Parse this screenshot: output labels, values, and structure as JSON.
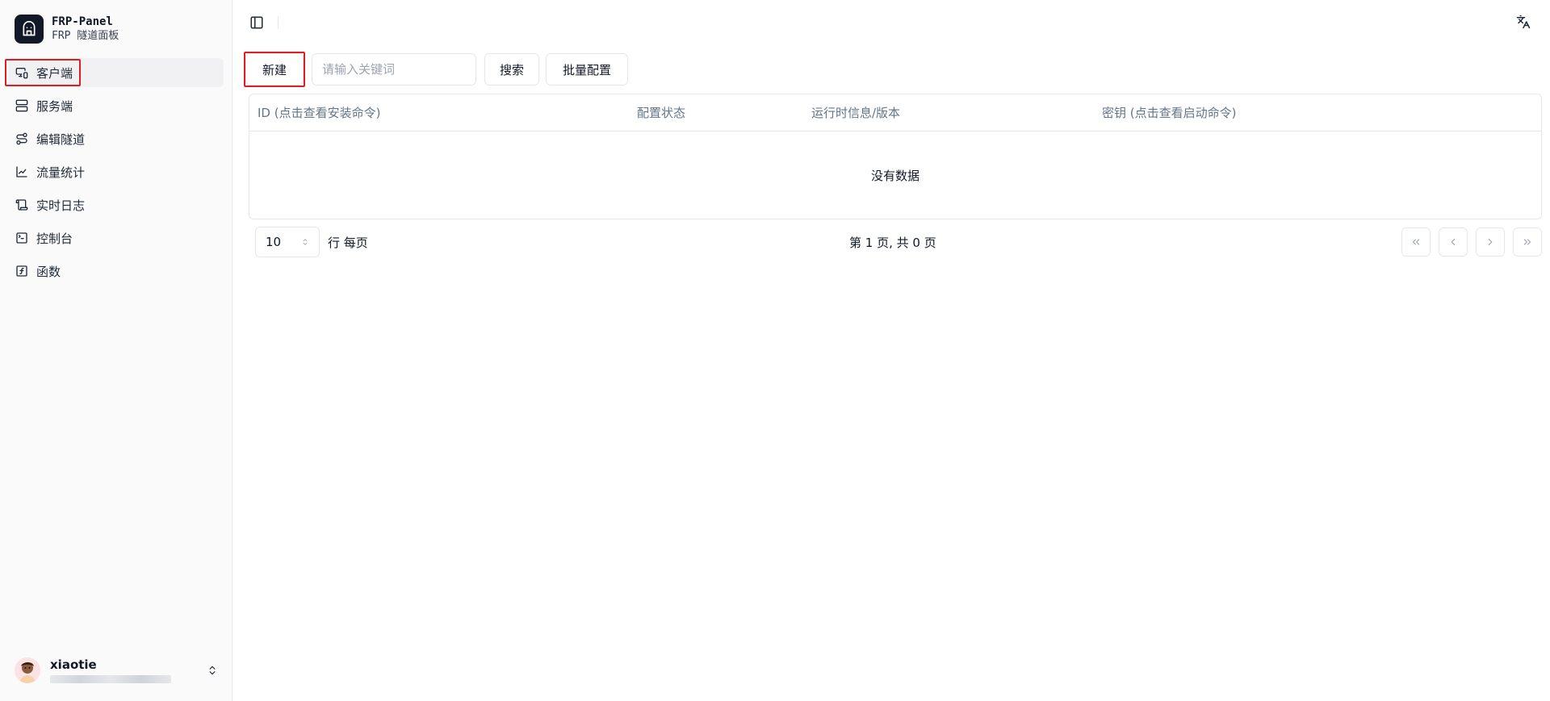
{
  "brand": {
    "title": "FRP-Panel",
    "subtitle": "FRP 隧道面板",
    "logo_icon": "building-icon"
  },
  "sidebar": {
    "items": [
      {
        "label": "客户端",
        "icon": "monitor-smartphone-icon",
        "active": true
      },
      {
        "label": "服务端",
        "icon": "server-icon",
        "active": false
      },
      {
        "label": "编辑隧道",
        "icon": "route-icon",
        "active": false
      },
      {
        "label": "流量统计",
        "icon": "chart-icon",
        "active": false
      },
      {
        "label": "实时日志",
        "icon": "scroll-icon",
        "active": false
      },
      {
        "label": "控制台",
        "icon": "terminal-icon",
        "active": false
      },
      {
        "label": "函数",
        "icon": "function-icon",
        "active": false
      }
    ]
  },
  "user": {
    "name": "xiaotie"
  },
  "toolbar": {
    "new_label": "新建",
    "search_placeholder": "请输入关键词",
    "search_label": "搜索",
    "batch_label": "批量配置"
  },
  "table": {
    "columns": [
      "ID (点击查看安装命令)",
      "配置状态",
      "运行时信息/版本",
      "密钥 (点击查看启动命令)"
    ],
    "empty_text": "没有数据"
  },
  "pagination": {
    "page_size": "10",
    "rows_label": "行 每页",
    "page_info": "第 1 页, 共 0 页"
  },
  "colors": {
    "highlight": "#e11d24",
    "sidebar_bg": "#fafafa",
    "active_bg": "#f1f1f3",
    "header_text": "#64748b"
  }
}
